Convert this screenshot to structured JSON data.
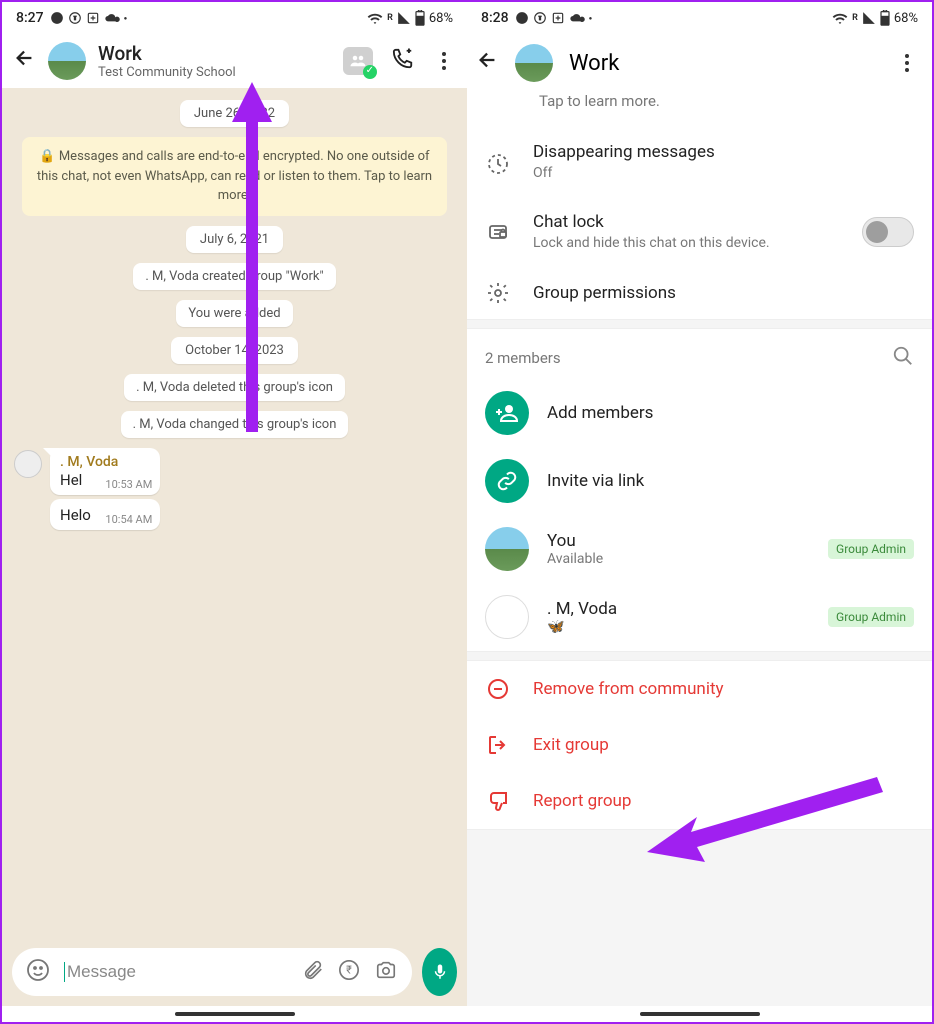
{
  "left": {
    "status": {
      "time": "8:27",
      "battery": "68%",
      "r": "R"
    },
    "header": {
      "name": "Work",
      "sub": "Test Community School"
    },
    "date1": "June 26, 2022",
    "enc": "🔒 Messages and calls are end-to-end encrypted. No one outside of this chat, not even WhatsApp, can read or listen to them. Tap to learn more.",
    "date2": "July 6, 2021",
    "sys1": ". M, Voda created group \"Work\"",
    "sys2": "You were added",
    "date3": "October 14, 2023",
    "sys3": ". M, Voda deleted this group's icon",
    "sys4": ". M, Voda changed this group's icon",
    "msg": {
      "sender": ". M, Voda",
      "m1": "Hel",
      "t1": "10:53 AM",
      "m2": "Helo",
      "t2": "10:54 AM"
    },
    "input_placeholder": "Message"
  },
  "right": {
    "status": {
      "time": "8:28",
      "battery": "68%",
      "r": "R"
    },
    "header": {
      "name": "Work"
    },
    "tap_more": "Tap to learn more.",
    "disappearing": {
      "title": "Disappearing messages",
      "sub": "Off"
    },
    "chatlock": {
      "title": "Chat lock",
      "sub": "Lock and hide this chat on this device."
    },
    "permissions": "Group permissions",
    "members_count": "2 members",
    "add_members": "Add members",
    "invite": "Invite via link",
    "you": {
      "name": "You",
      "sub": "Available",
      "badge": "Group Admin"
    },
    "voda": {
      "name": ". M, Voda",
      "sub": "🦋",
      "badge": "Group Admin"
    },
    "remove": "Remove from community",
    "exit": "Exit group",
    "report": "Report group"
  }
}
